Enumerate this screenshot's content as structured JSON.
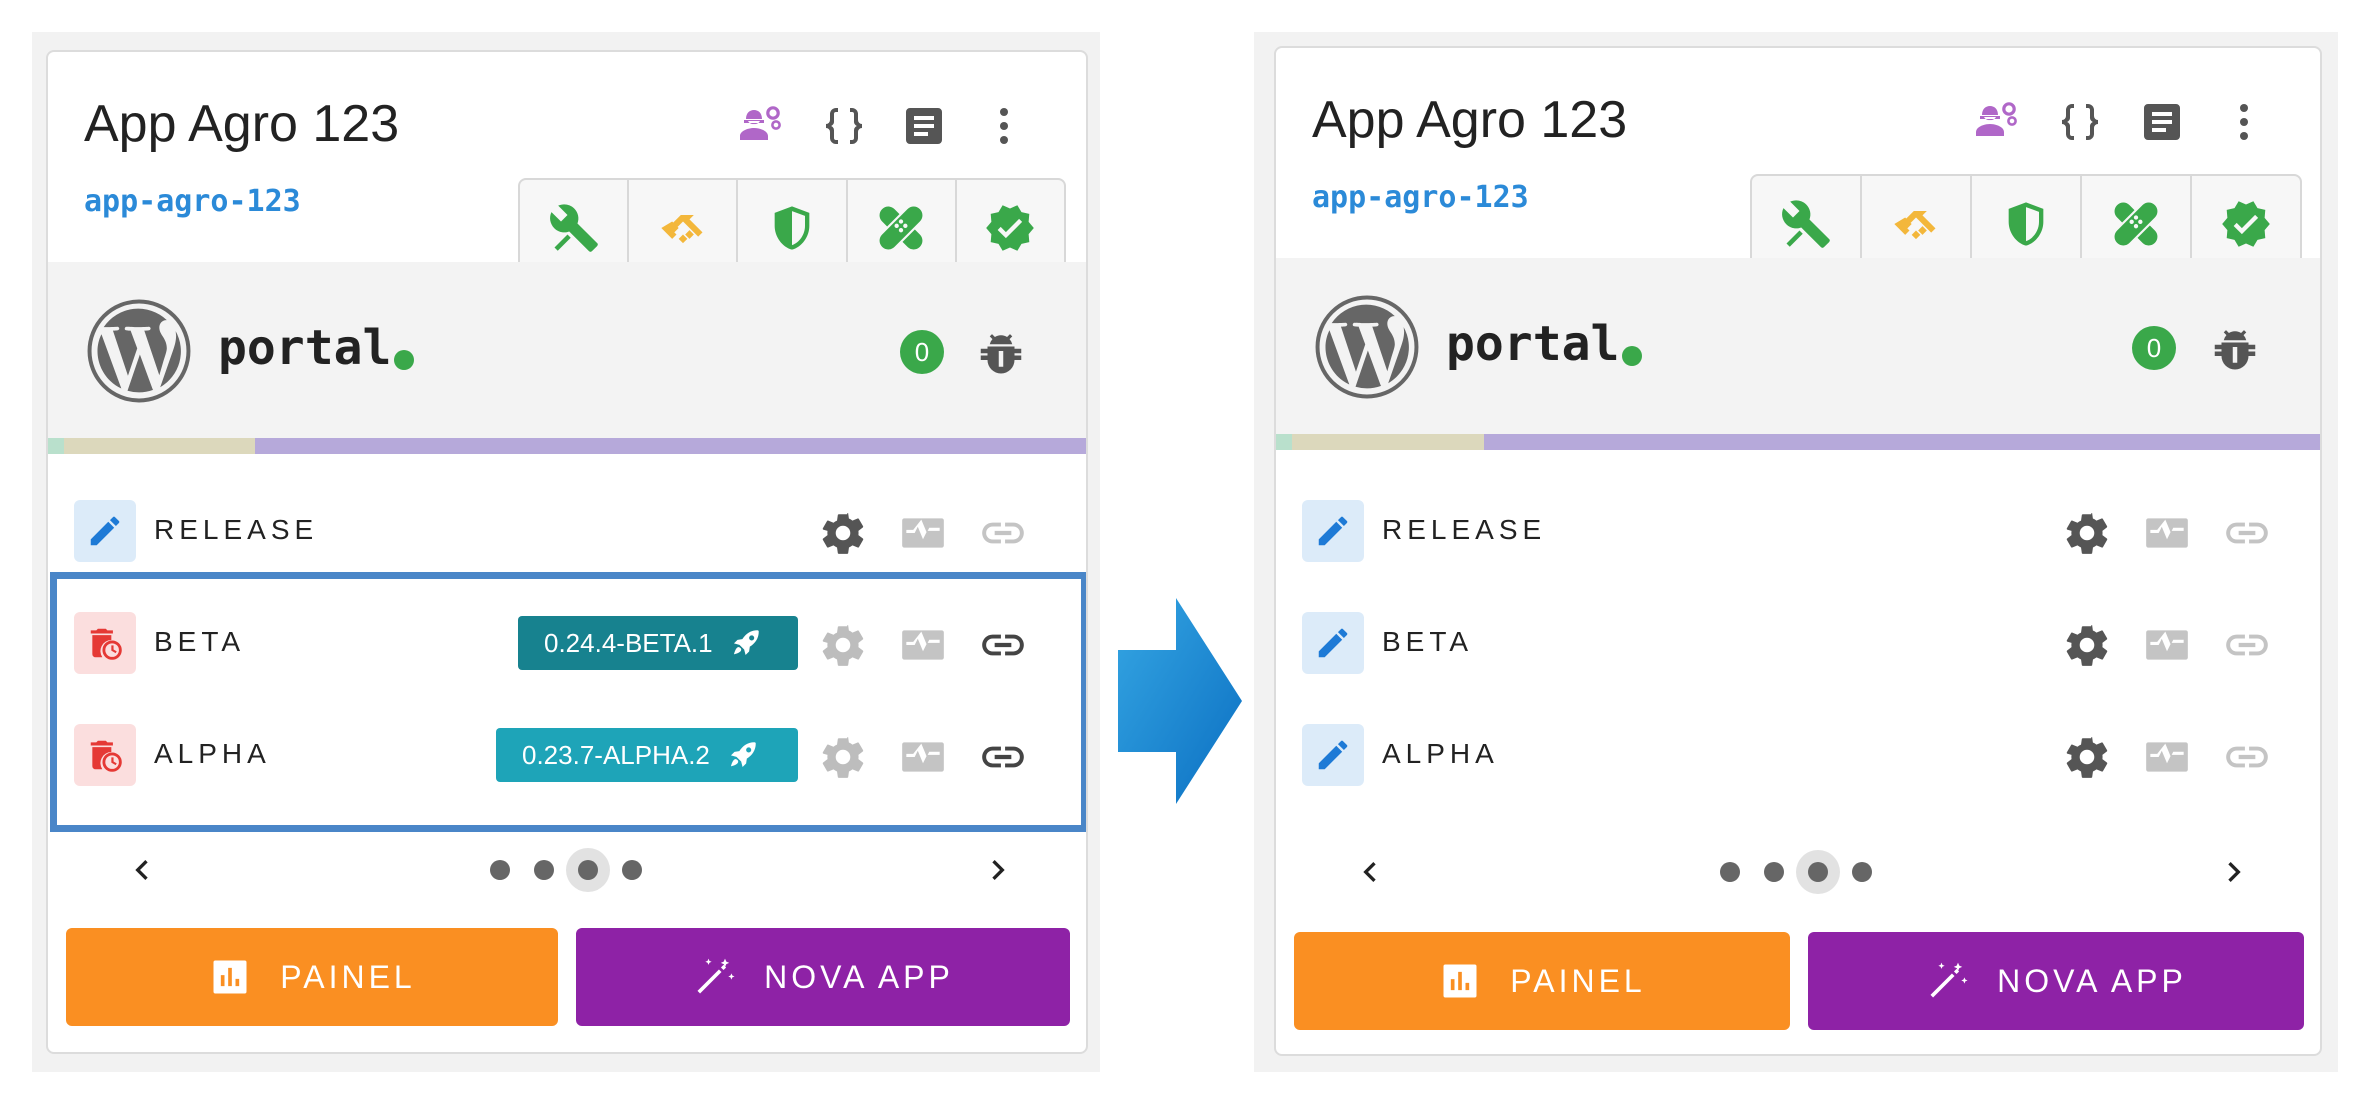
{
  "colors": {
    "slug": "#2b8ad8",
    "status_ok": "#3aa84a",
    "beta_chip": "#17828f",
    "alpha_chip": "#1ea4b8",
    "painel": "#fa8f22",
    "nova_app": "#8e22a6",
    "highlight": "#4a86c8",
    "delete_icon": "#e53935",
    "edit_icon": "#1e7ad6"
  },
  "before": {
    "header": {
      "title": "App Agro 123",
      "slug": "app-agro-123",
      "icons": [
        "engineer-gears-icon",
        "code-braces-icon",
        "document-icon",
        "more-vertical-icon"
      ],
      "tabs": [
        "tools-icon",
        "handshake-icon",
        "shield-icon",
        "bandage-icon",
        "verified-badge-icon"
      ]
    },
    "project": {
      "name": "portal",
      "logo": "wordpress-logo-icon",
      "status": "online",
      "issue_count": "0",
      "bug_icon": "bug-icon"
    },
    "progress_segments": [
      {
        "color": "#b9e0cc",
        "fraction": 0.015
      },
      {
        "color": "#dcd8bc",
        "fraction": 0.184
      },
      {
        "color": "#b6a9da",
        "fraction": 0.801
      }
    ],
    "environments": [
      {
        "label": "RELEASE",
        "icon": "pencil-icon",
        "version": ""
      },
      {
        "label": "BETA",
        "icon": "delete-clock-icon",
        "version": "0.24.4-BETA.1"
      },
      {
        "label": "ALPHA",
        "icon": "delete-clock-icon",
        "version": "0.23.7-ALPHA.2"
      }
    ],
    "pager": {
      "pages": 4,
      "current": 3
    },
    "buttons": {
      "painel": "PAINEL",
      "nova_app": "NOVA APP"
    }
  },
  "after": {
    "header": {
      "title": "App Agro 123",
      "slug": "app-agro-123"
    },
    "project": {
      "name": "portal",
      "issue_count": "0"
    },
    "environments": [
      {
        "label": "RELEASE",
        "icon": "pencil-icon"
      },
      {
        "label": "BETA",
        "icon": "pencil-icon"
      },
      {
        "label": "ALPHA",
        "icon": "pencil-icon"
      }
    ],
    "pager": {
      "pages": 4,
      "current": 3
    },
    "buttons": {
      "painel": "PAINEL",
      "nova_app": "NOVA APP"
    }
  },
  "transition_arrow": "arrow-right-icon"
}
